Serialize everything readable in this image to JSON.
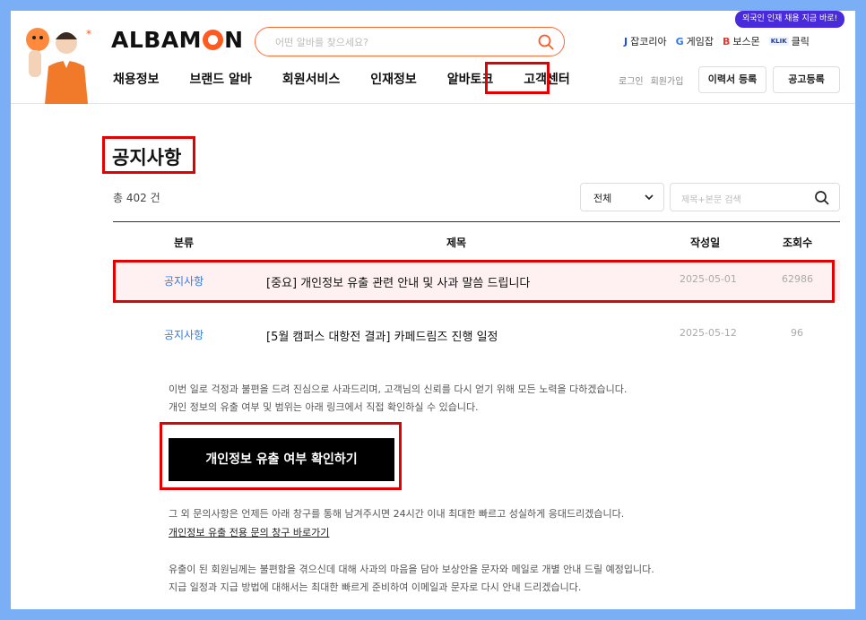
{
  "brand": {
    "logo_pre": "ALBAM",
    "logo_post": "N",
    "accent": "#ff5a1f"
  },
  "search": {
    "placeholder": "어떤 알바를 찾으세요?"
  },
  "promo": {
    "text": "외국인 인재 채용 지금 바로!"
  },
  "partners": [
    {
      "mark": "J",
      "label": "잡코리아"
    },
    {
      "mark": "G",
      "label": "게임잡"
    },
    {
      "mark": "B",
      "label": "보스몬"
    },
    {
      "mark": "KLIK",
      "label": "클릭"
    }
  ],
  "nav": [
    "채용정보",
    "브랜드 알바",
    "회원서비스",
    "인재정보",
    "알바토크",
    "고객센터"
  ],
  "user_links": {
    "login": "로그인",
    "signup": "회원가입"
  },
  "buttons": {
    "resume": "이력서 등록",
    "post": "공고등록"
  },
  "page": {
    "title": "공지사항",
    "count": "총 402 건"
  },
  "filter": {
    "selected": "전체",
    "keyword_placeholder": "제목+본문 검색"
  },
  "table": {
    "headers": {
      "category": "분류",
      "subject": "제목",
      "date": "작성일",
      "views": "조회수"
    },
    "rows": [
      {
        "category": "공지사항",
        "subject": "[중요] 개인정보 유출 관련 안내 및 사과 말씀 드립니다",
        "date": "2025-05-01",
        "views": "62986"
      },
      {
        "category": "공지사항",
        "subject": "[5월 캠퍼스 대항전 결과] 카페드림즈 진행 일정",
        "date": "2025-05-12",
        "views": "96"
      }
    ]
  },
  "body": {
    "p1_line1": "이번 일로 걱정과 불편을 드려 진심으로 사과드리며, 고객님의 신뢰를 다시 얻기 위해 모든 노력을 다하겠습니다.",
    "p1_line2": "개인 정보의 유출 여부 및 범위는 아래 링크에서 직접 확인하실 수 있습니다.",
    "cta": "개인정보 유출 여부 확인하기",
    "p2_line1": "그 외 문의사항은 언제든 아래 창구를 통해 남겨주시면 24시간 이내 최대한 빠르고 성실하게 응대드리겠습니다.",
    "link": "개인정보 유출 전용 문의 창구 바로가기",
    "p3_line1": "유출이 된 회원님께는 불편함을 겪으신데 대해 사과의 마음을 담아 보상안을 문자와 메일로 개별 안내 드릴 예정입니다.",
    "p3_line2": "지급 일정과 지급 방법에 대해서는 최대한 빠르게 준비하여 이메일과 문자로 다시 안내 드리겠습니다."
  }
}
